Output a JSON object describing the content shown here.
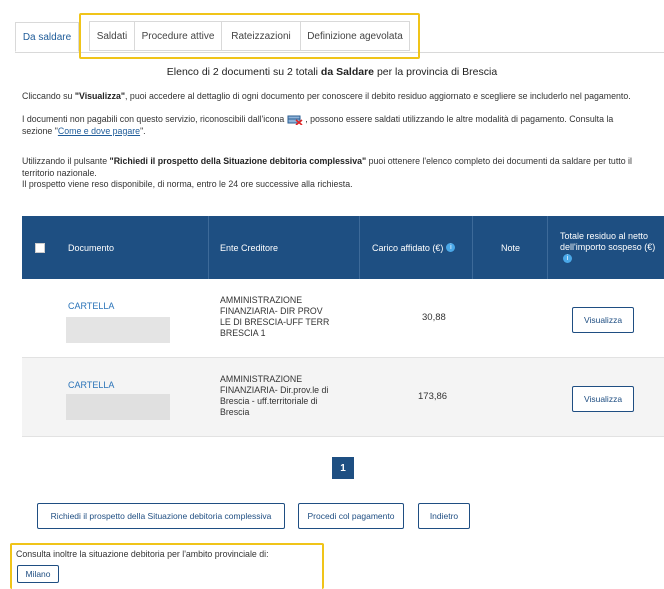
{
  "tabs": [
    "Da saldare",
    "Saldati",
    "Procedure attive",
    "Rateizzazioni",
    "Definizione agevolata"
  ],
  "title": {
    "prefix": "Elenco di 2 documenti su 2 totali",
    "middle": "da Saldare",
    "suffix": "per la provincia di Brescia"
  },
  "intro": {
    "p1_a": "Cliccando su ",
    "p1_b": "\"Visualizza\"",
    "p1_c": ", puoi accedere al dettaglio di ogni documento per conoscere il debito residuo aggiornato e scegliere se includerlo nel pagamento.",
    "p2_a": "I documenti non pagabili con questo servizio, riconoscibili dall'icona",
    "p2_b": ", possono essere saldati utilizzando le altre modalità di pagamento. Consulta la",
    "p2_c": "sezione \"",
    "p2_link": "Come e dove pagare",
    "p2_d": "\".",
    "p3_a": "Utilizzando il pulsante ",
    "p3_b": "\"Richiedi il prospetto della Situazione debitoria complessiva\"",
    "p3_c": " puoi ottenere l'elenco completo dei documenti da saldare per tutto il territorio nazionale.",
    "p4": "Il prospetto viene reso disponibile, di norma, entro le 24 ore successive alla richiesta."
  },
  "table": {
    "headers": {
      "documento": "Documento",
      "ente": "Ente Creditore",
      "carico": "Carico affidato (€)",
      "note": "Note",
      "totale": "Totale residuo al netto dell'importo sospeso (€)"
    },
    "rows": [
      {
        "doc": "CARTELLA",
        "ente": "AMMINISTRAZIONE FINANZIARIA- DIR PROV LE DI BRESCIA-UFF TERR BRESCIA 1",
        "carico": "30,88",
        "action": "Visualizza"
      },
      {
        "doc": "CARTELLA",
        "ente": "AMMINISTRAZIONE FINANZIARIA- Dir.prov.le di Brescia - uff.territoriale di Brescia",
        "carico": "173,86",
        "action": "Visualizza"
      }
    ],
    "info_glyph": "i"
  },
  "pagination": {
    "current": "1"
  },
  "actions": {
    "prospetto": "Richiedi il prospetto della Situazione debitoria complessiva",
    "procedi": "Procedi col pagamento",
    "indietro": "Indietro"
  },
  "footer": {
    "text": "Consulta inoltre la situazione debitoria per l'ambito provinciale di:",
    "province": "Milano"
  },
  "colors": {
    "header_bg": "#1e4f82",
    "highlight": "#f0c419",
    "link": "#1f5c99"
  }
}
